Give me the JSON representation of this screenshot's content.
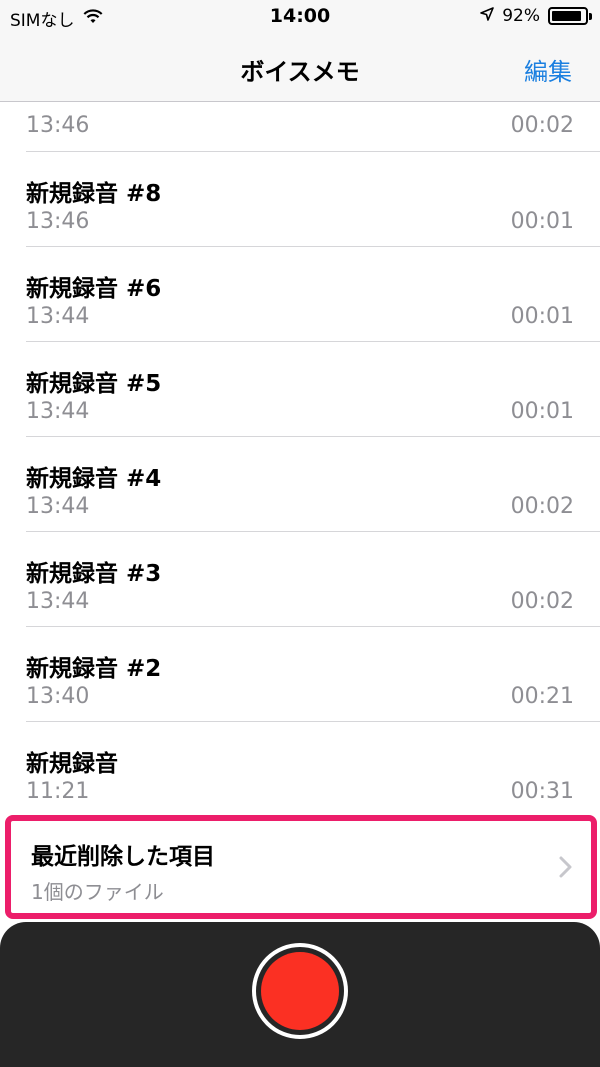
{
  "status_bar": {
    "carrier": "SIMなし",
    "time": "14:00",
    "battery_percent": "92%",
    "battery_level": 0.92
  },
  "nav": {
    "title": "ボイスメモ",
    "edit_label": "編集"
  },
  "recordings": [
    {
      "title": "",
      "time": "13:46",
      "duration": "00:02"
    },
    {
      "title": "新規録音 #8",
      "time": "13:46",
      "duration": "00:01"
    },
    {
      "title": "新規録音 #6",
      "time": "13:44",
      "duration": "00:01"
    },
    {
      "title": "新規録音 #5",
      "time": "13:44",
      "duration": "00:01"
    },
    {
      "title": "新規録音 #4",
      "time": "13:44",
      "duration": "00:02"
    },
    {
      "title": "新規録音 #3",
      "time": "13:44",
      "duration": "00:02"
    },
    {
      "title": "新規録音 #2",
      "time": "13:40",
      "duration": "00:21"
    },
    {
      "title": "新規録音",
      "time": "11:21",
      "duration": "00:31"
    }
  ],
  "recently_deleted": {
    "title": "最近削除した項目",
    "subtitle": "1個のファイル"
  },
  "colors": {
    "accent": "#1a7fe0",
    "record": "#fb3023",
    "highlight": "#ec1e6a",
    "panel": "#262626"
  }
}
